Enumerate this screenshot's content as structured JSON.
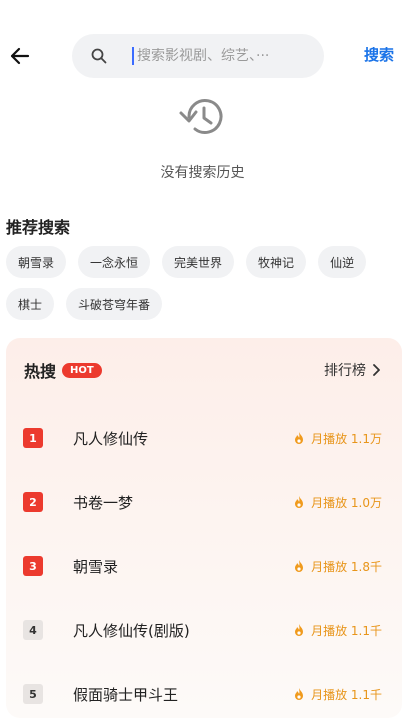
{
  "header": {
    "search_placeholder": "搜索影视剧、综艺、···",
    "search_button": "搜索"
  },
  "history": {
    "empty_text": "没有搜索历史"
  },
  "recommend": {
    "title": "推荐搜索",
    "tags": [
      "朝雪录",
      "一念永恒",
      "完美世界",
      "牧神记",
      "仙逆",
      "棋士",
      "斗破苍穹年番"
    ]
  },
  "hot": {
    "title": "热搜",
    "badge": "HOT",
    "rank_link": "排行榜",
    "items": [
      {
        "rank": "1",
        "name": "凡人修仙传",
        "stat": "月播放 1.1万"
      },
      {
        "rank": "2",
        "name": "书卷一梦",
        "stat": "月播放 1.0万"
      },
      {
        "rank": "3",
        "name": "朝雪录",
        "stat": "月播放 1.8千"
      },
      {
        "rank": "4",
        "name": "凡人修仙传(剧版)",
        "stat": "月播放 1.1千"
      },
      {
        "rank": "5",
        "name": "假面骑士甲斗王",
        "stat": "月播放 1.1千"
      }
    ]
  },
  "colors": {
    "accent": "#1a73e8",
    "hot_red": "#ec3a2e",
    "stat_orange": "#e8951a"
  },
  "icons": [
    "back-arrow-icon",
    "search-icon",
    "history-icon",
    "chevron-right-icon",
    "flame-icon"
  ]
}
